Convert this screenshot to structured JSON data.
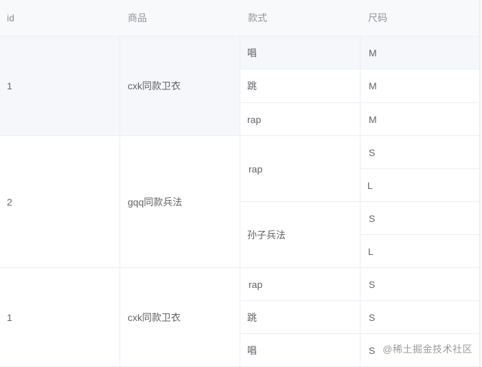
{
  "table": {
    "headers": [
      "id",
      "商品",
      "款式",
      "尺码"
    ],
    "rows": [
      {
        "id": "1",
        "product": "cxk同款卫衣",
        "styles": [
          {
            "name": "唱",
            "sizes": [
              "M"
            ]
          },
          {
            "name": "跳",
            "sizes": [
              "M"
            ]
          },
          {
            "name": "rap",
            "sizes": [
              "M"
            ]
          }
        ]
      },
      {
        "id": "2",
        "product": "gqq同款兵法",
        "styles": [
          {
            "name": "rap",
            "sizes": [
              "S",
              "L"
            ]
          },
          {
            "name": "孙子兵法",
            "sizes": [
              "S",
              "L"
            ]
          }
        ]
      },
      {
        "id": "1",
        "product": "cxk同款卫衣",
        "styles": [
          {
            "name": "rap",
            "sizes": [
              "S"
            ]
          },
          {
            "name": "跳",
            "sizes": [
              "S"
            ]
          },
          {
            "name": "唱",
            "sizes": [
              "S"
            ]
          }
        ]
      }
    ]
  },
  "watermark": "@稀土掘金技术社区"
}
